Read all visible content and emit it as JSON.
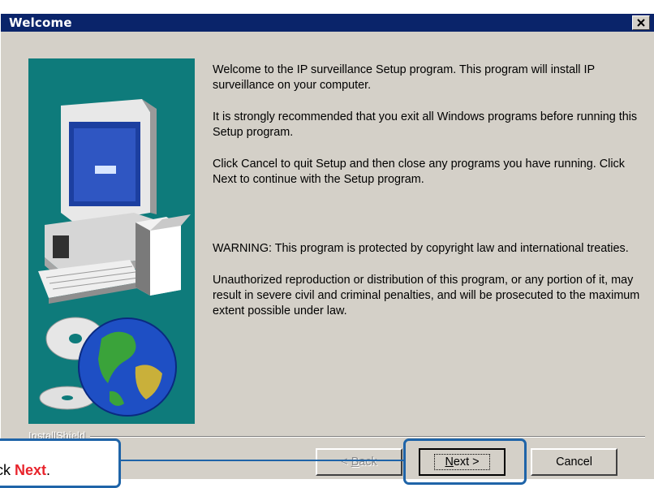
{
  "window": {
    "title": "Welcome",
    "close_glyph": "×"
  },
  "content": {
    "paragraphs": [
      "Welcome to the IP surveillance Setup program.  This program will install IP surveillance on your computer.",
      "It is strongly recommended that you exit all Windows programs before running this Setup program.",
      "Click Cancel to quit Setup and then close any programs you have running.  Click Next to continue with the Setup program.",
      "WARNING: This program is protected by copyright law and international treaties.",
      "Unauthorized reproduction or distribution of this program, or any portion of it, may result in severe civil and criminal penalties, and will be prosecuted to the maximum extent possible under law."
    ]
  },
  "brand": "InstallShield",
  "buttons": {
    "back": {
      "before": "< ",
      "key": "B",
      "after": "ack",
      "enabled": false
    },
    "next": {
      "key": "N",
      "after": "ext >",
      "default": true
    },
    "cancel": {
      "label": "Cancel"
    }
  },
  "callout": {
    "prefix": "ck ",
    "emphasis": "Next",
    "suffix": ".",
    "emphasis_color": "#e8242c",
    "border_color": "#1f64a8"
  },
  "colors": {
    "titlebar": "#0a246a",
    "dialog_face": "#d4d0c8",
    "graphic_bg": "#0e7b7b"
  },
  "graphic_icons": [
    "computer-icon",
    "cd-disc-icon",
    "globe-icon"
  ]
}
